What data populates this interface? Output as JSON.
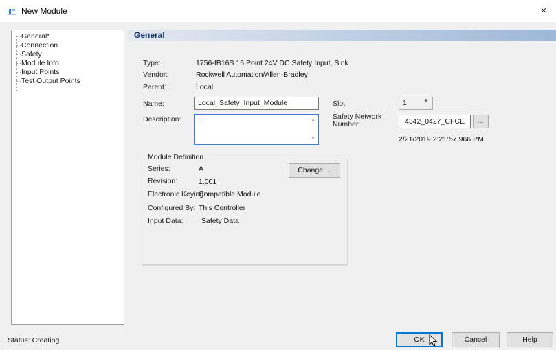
{
  "window": {
    "title": "New Module",
    "close_glyph": "×",
    "icon": "module-icon"
  },
  "tree": {
    "items": [
      "General*",
      "Connection",
      "Safety",
      "Module Info",
      "Input Points",
      "Test Output Points"
    ],
    "selected_index": 0
  },
  "panel": {
    "header": "General"
  },
  "fields": {
    "type_label": "Type:",
    "type_value": "1756-IB16S 16 Point 24V DC Safety Input, Sink",
    "vendor_label": "Vendor:",
    "vendor_value": "Rockwell Automation/Allen-Bradley",
    "parent_label": "Parent:",
    "parent_value": "Local",
    "name_label": "Name:",
    "name_value": "Local_Safety_Input_Module",
    "description_label": "Description:",
    "description_value": "",
    "slot_label": "Slot:",
    "slot_value": "1",
    "snn_label_line1": "Safety Network",
    "snn_label_line2": "Number:",
    "snn_value": "4342_0427_CFCE",
    "snn_button": "...",
    "timestamp": "2/21/2019 2:21:57.966 PM"
  },
  "module_definition": {
    "title": "Module Definition",
    "series_label": "Series:",
    "series_value": "A",
    "revision_label": "Revision:",
    "revision_value": "1.001",
    "keying_label": "Electronic Keying:",
    "keying_value": "Compatible Module",
    "configured_label": "Configured By:",
    "configured_value": "This Controller",
    "input_label": "Input Data:",
    "input_value": "Safety Data",
    "change_button": "Change ..."
  },
  "status": {
    "text": "Status:  Creating"
  },
  "buttons": {
    "ok": "OK",
    "cancel": "Cancel",
    "help": "Help"
  },
  "colors": {
    "header_gradient_start": "#e4e9f1",
    "header_gradient_end": "#9db8d8",
    "header_text": "#14336e",
    "focus_border": "#3d7bd4",
    "default_button_border": "#0078d7"
  }
}
